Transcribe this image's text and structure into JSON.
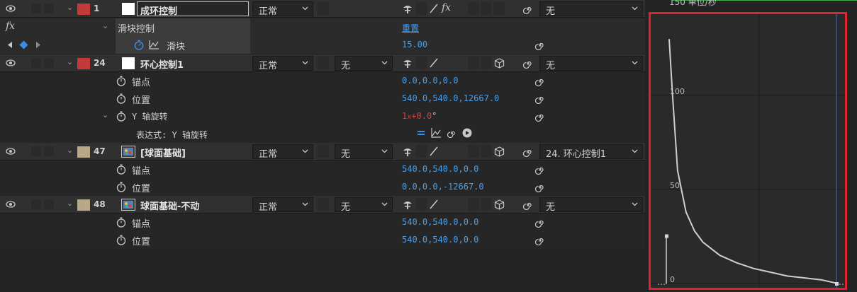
{
  "layers": [
    {
      "number": "1",
      "name": "成环控制",
      "label_color": "#c23a3a",
      "mode": "正常",
      "parent": "无",
      "effect": {
        "fx_label": "fx",
        "name": "滑块控制",
        "reset": "重置",
        "slider_label": "滑块",
        "slider_value": "15.00"
      }
    },
    {
      "number": "24",
      "name": "环心控制1",
      "label_color": "#c23a3a",
      "mode": "正常",
      "trkmat": "无",
      "parent": "无",
      "properties": [
        {
          "name": "锚点",
          "value": "0.0,0.0,0.0"
        },
        {
          "name": "位置",
          "value": "540.0,540.0,12667.0"
        },
        {
          "name": "Y 轴旋转",
          "value_rev": "1",
          "value_x": "x",
          "value_deg": "+0.0",
          "value_unit": "°"
        }
      ],
      "expression_label": "表达式: Y 轴旋转"
    },
    {
      "number": "47",
      "name": "[球面基础]",
      "label_color": "#b8a888",
      "mode": "正常",
      "trkmat": "无",
      "parent": "24. 环心控制1",
      "properties": [
        {
          "name": "锚点",
          "value": "540.0,540.0,0.0"
        },
        {
          "name": "位置",
          "value": "0.0,0.0,-12667.0"
        }
      ]
    },
    {
      "number": "48",
      "name": "球面基础-不动",
      "label_color": "#b8a888",
      "mode": "正常",
      "trkmat": "无",
      "parent": "无",
      "properties": [
        {
          "name": "锚点",
          "value": "540.0,540.0,0.0"
        },
        {
          "name": "位置",
          "value": "540.0,540.0,0.0"
        }
      ]
    }
  ],
  "graph": {
    "header": "150 单位/秒",
    "ticks": [
      "100",
      "50",
      "0"
    ],
    "highlight_color": "#e0242c"
  },
  "chart_data": {
    "type": "line",
    "title": "",
    "ylabel": "单位/秒",
    "ylim": [
      0,
      150
    ],
    "ticks_y": [
      0,
      50,
      100,
      150
    ],
    "series": [
      {
        "x": [
          0.0,
          0.02,
          0.05,
          0.1,
          0.15,
          0.2,
          0.3,
          0.4,
          0.5,
          0.6,
          0.7,
          0.8,
          0.9,
          1.0
        ],
        "y": [
          130,
          100,
          60,
          38,
          28,
          22,
          15,
          11,
          8,
          6,
          4,
          3,
          2,
          0
        ]
      }
    ]
  }
}
